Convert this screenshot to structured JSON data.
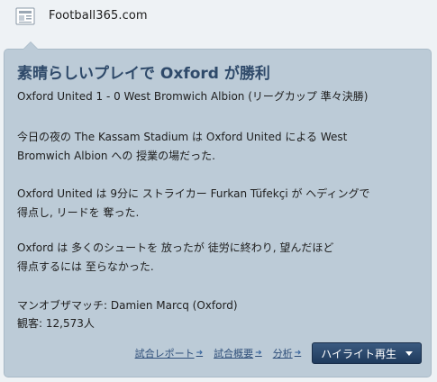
{
  "source": {
    "name": "Football365.com",
    "icon": "newspaper-icon"
  },
  "article": {
    "headline": "素晴らしいプレイで Oxford が勝利",
    "result": "Oxford United 1 - 0 West Bromwich Albion (リーグカップ 準々決勝)",
    "stadium_line1": "今日の夜の The Kassam Stadium は Oxford United による West",
    "stadium_line2": "Bromwich Albion への 授業の場だった.",
    "goal_line1": "Oxford United は 9分に ストライカー Furkan Tüfekçi が ヘディングで",
    "goal_line2": "得点し, リードを 奪った.",
    "final_line1": "Oxford は 多くのシュートを 放ったが 徒労に終わり, 望んだほど",
    "final_line2": "得点するには 至らなかった.",
    "man_of_match": "マンオブザマッチ: Damien Marcq (Oxford)",
    "attendance": "観客: 12,573人"
  },
  "actions": {
    "match_report": "試合レポート",
    "match_summary": "試合概要",
    "analysis": "分析",
    "highlights_button": "ハイライト再生"
  },
  "colors": {
    "card_background": "#bccbd7",
    "headline": "#2f4a6a",
    "button": "#1f3a5c"
  }
}
